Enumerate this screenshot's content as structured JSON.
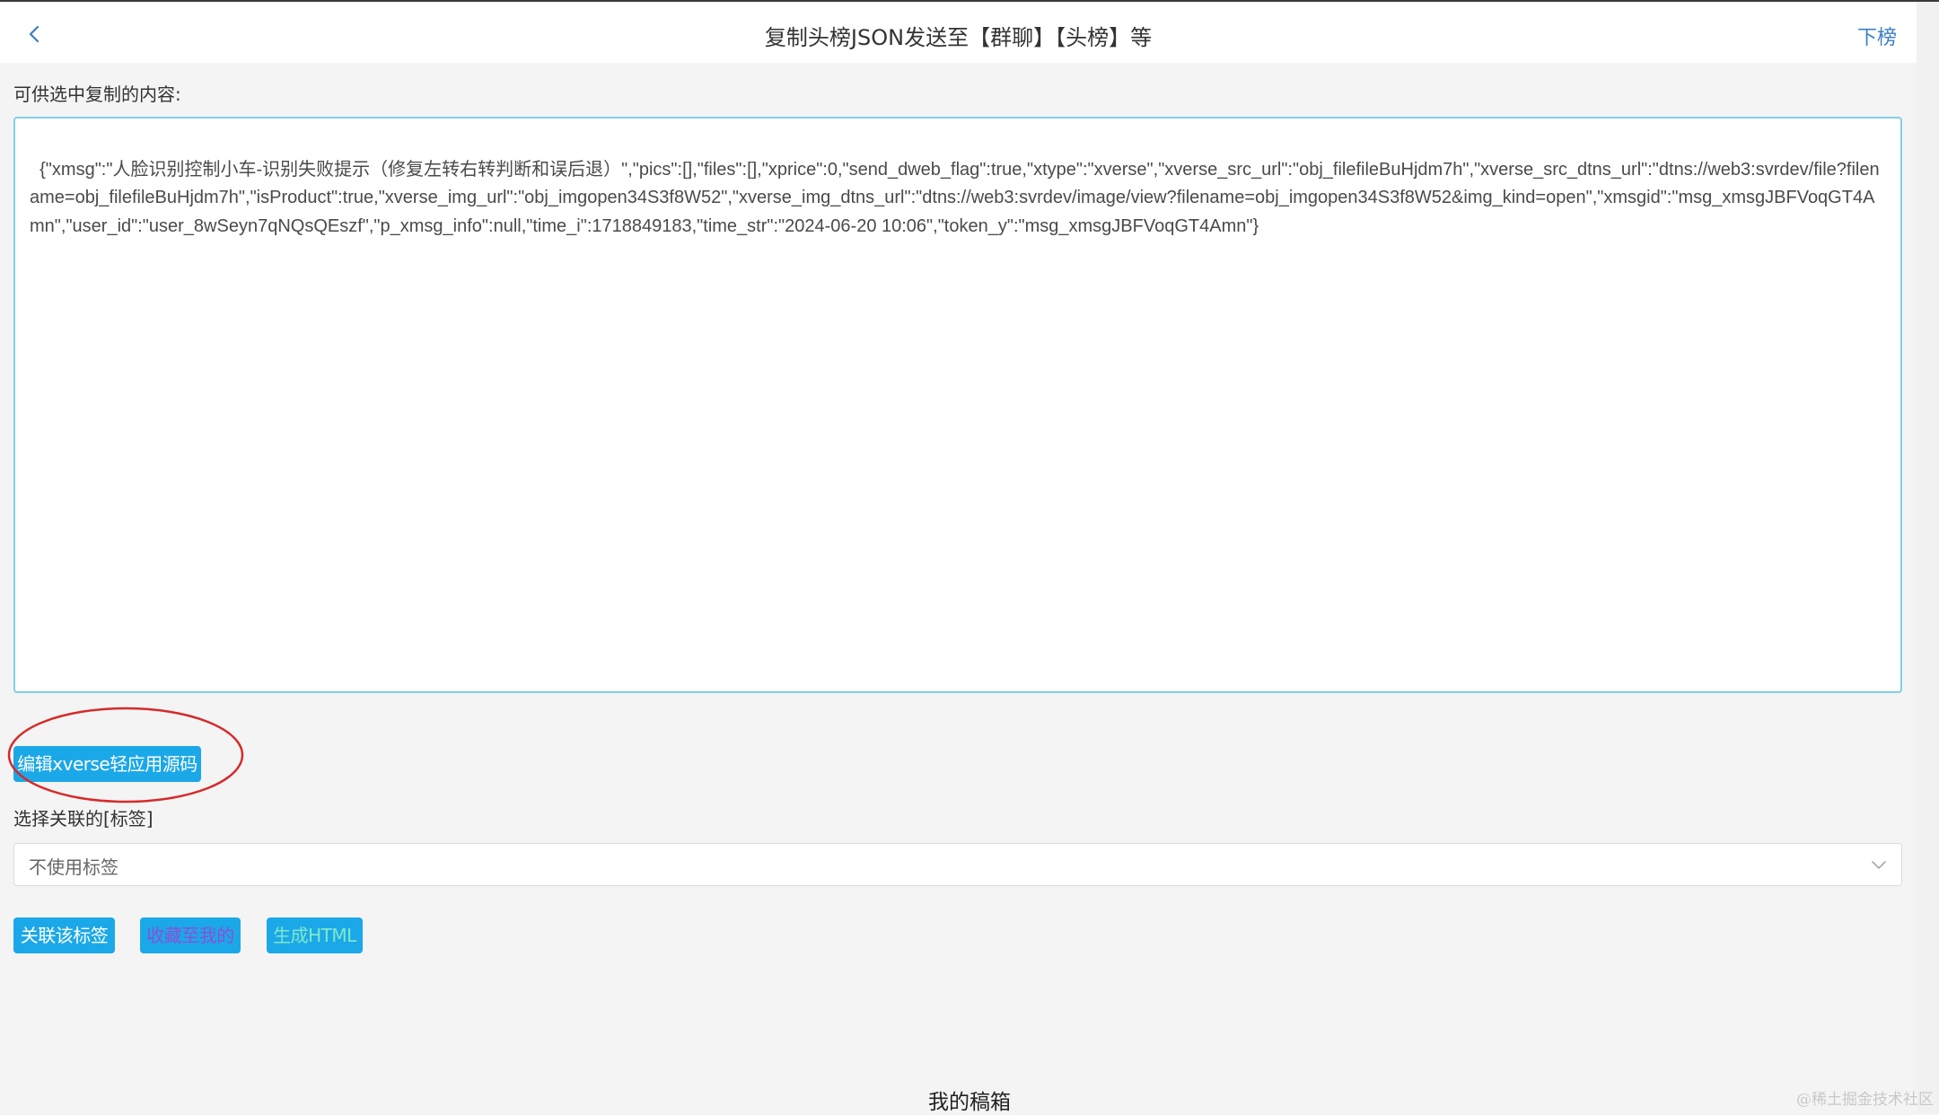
{
  "header": {
    "back_icon": "chevron-left-icon",
    "title": "复制头榜JSON发送至【群聊】【头榜】等",
    "next_label": "下榜"
  },
  "content": {
    "copy_label": "可供选中复制的内容:",
    "json_text": "{\"xmsg\":\"人脸识别控制小车-识别失败提示（修复左转右转判断和误后退）\",\"pics\":[],\"files\":[],\"xprice\":0,\"send_dweb_flag\":true,\"xtype\":\"xverse\",\"xverse_src_url\":\"obj_filefileBuHjdm7h\",\"xverse_src_dtns_url\":\"dtns://web3:svrdev/file?filename=obj_filefileBuHjdm7h\",\"isProduct\":true,\"xverse_img_url\":\"obj_imgopen34S3f8W52\",\"xverse_img_dtns_url\":\"dtns://web3:svrdev/image/view?filename=obj_imgopen34S3f8W52&img_kind=open\",\"xmsgid\":\"msg_xmsgJBFVoqGT4Amn\",\"user_id\":\"user_8wSeyn7qNQsQEszf\",\"p_xmsg_info\":null,\"time_i\":1718849183,\"time_str\":\"2024-06-20 10:06\",\"token_y\":\"msg_xmsgJBFVoqGT4Amn\"}",
    "edit_source_button": "编辑xverse轻应用源码",
    "tag_label": "选择关联的[标签]",
    "tag_select_value": "不使用标签",
    "tag_select_icon": "chevron-down-icon"
  },
  "actions": [
    {
      "label": "关联该标签",
      "text_color": "#ffffff"
    },
    {
      "label": "收藏至我的",
      "text_color": "#8a4fd8"
    },
    {
      "label": "生成HTML",
      "text_color": "#7fe8c8"
    }
  ],
  "footer": {
    "label": "我的稿箱",
    "watermark": "@稀土掘金技术社区"
  },
  "colors": {
    "accent": "#1ba8e8",
    "highlight_ellipse": "#d62a2a",
    "link": "#3a7ec6"
  }
}
